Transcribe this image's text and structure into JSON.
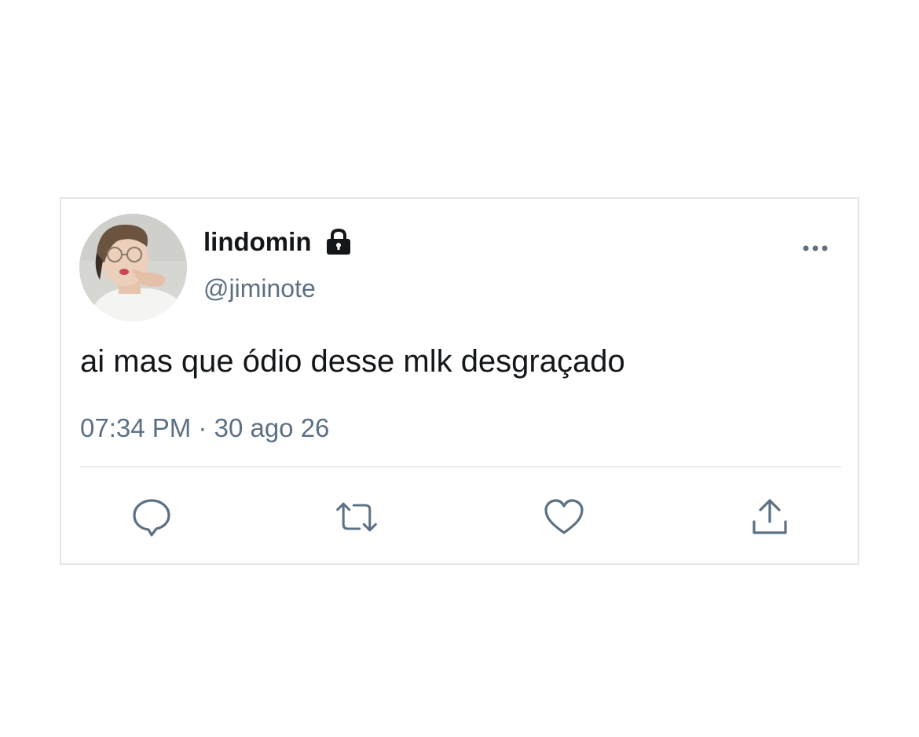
{
  "tweet": {
    "display_name": "lindomin",
    "handle": "@jiminote",
    "text": "ai mas que ódio desse mlk desgraçado",
    "time": "07:34 PM",
    "separator": "·",
    "date": "30 ago 26"
  },
  "icons": {
    "lock": "lock-icon",
    "more": "more-horizontal-icon",
    "reply": "reply-icon",
    "retweet": "retweet-icon",
    "like": "heart-icon",
    "share": "share-icon"
  },
  "colors": {
    "text_primary": "#14171a",
    "text_secondary": "#5b7083",
    "icon": "#5b7083",
    "border": "#e3e6e8"
  }
}
